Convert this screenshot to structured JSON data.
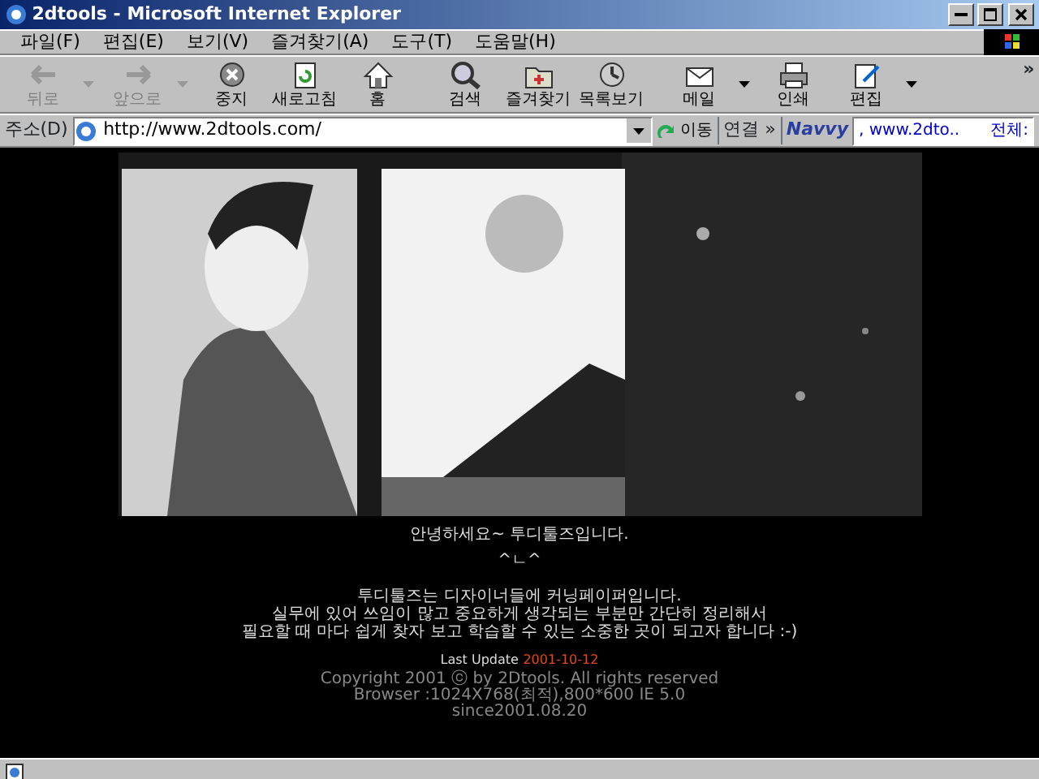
{
  "window": {
    "title": "2dtools - Microsoft Internet Explorer"
  },
  "menu": [
    "파일(F)",
    "편집(E)",
    "보기(V)",
    "즐겨찾기(A)",
    "도구(T)",
    "도움말(H)"
  ],
  "toolbar": [
    {
      "label": "뒤로",
      "disabled": true,
      "dropdown": true
    },
    {
      "label": "앞으로",
      "disabled": true,
      "dropdown": true
    },
    {
      "label": "중지",
      "disabled": false,
      "dropdown": false
    },
    {
      "label": "새로고침",
      "disabled": false,
      "dropdown": false
    },
    {
      "label": "홈",
      "disabled": false,
      "dropdown": false
    },
    {
      "label": "검색",
      "disabled": false,
      "dropdown": false
    },
    {
      "label": "즐겨찾기",
      "disabled": false,
      "dropdown": false
    },
    {
      "label": "목록보기",
      "disabled": false,
      "dropdown": false
    },
    {
      "label": "메일",
      "disabled": false,
      "dropdown": true
    },
    {
      "label": "인쇄",
      "disabled": false,
      "dropdown": false
    },
    {
      "label": "편집",
      "disabled": false,
      "dropdown": true
    }
  ],
  "toolbar_more": "»",
  "address_bar": {
    "label": "주소(D)",
    "value": "http://www.2dtools.com/",
    "go": "이동",
    "links": "연결 »"
  },
  "navvy": {
    "logo": "Navvy",
    "value": ", www.2dto..",
    "label": "전체:"
  },
  "page": {
    "greeting": "안녕하세요~ 투디툴즈입니다.",
    "smiley": "^ㄴ^",
    "intro": [
      "투디툴즈는 디자이너들에 커닝페이퍼입니다.",
      "실무에 있어 쓰임이 많고 중요하게 생각되는 부분만 간단히 정리해서",
      "필요할 때 마다 쉽게 찾자 보고 학습할 수 있는 소중한 곳이 되고자 합니다 :-)"
    ],
    "last_update_label": "Last Update",
    "last_update": "2001-10-12",
    "footer": [
      "Copyright 2001 ⓒ by 2Dtools. All rights reserved",
      "Browser :1024X768(최적),800*600 IE 5.0",
      "since2001.08.20"
    ]
  }
}
